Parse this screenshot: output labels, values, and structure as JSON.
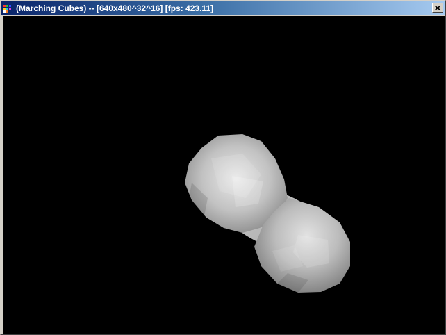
{
  "window": {
    "title": "(Marching Cubes) -- [640x480^32^16] [fps: 423.11]",
    "icons": {
      "app": "app-icon",
      "close": "close-icon"
    }
  },
  "viewport": {
    "background": "#000000",
    "object": "metaball-blob"
  },
  "colors": {
    "titlebar_start": "#0a246a",
    "titlebar_end": "#a6caf0",
    "blob_light": "#e6e6e6",
    "blob_mid": "#b4b4b4",
    "blob_dark": "#7a7a7a"
  }
}
